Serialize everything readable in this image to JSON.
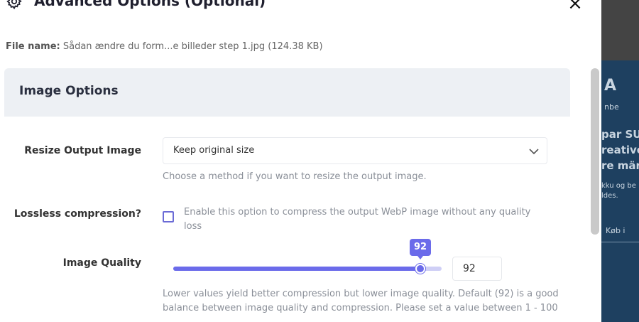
{
  "dialog": {
    "title": "Advanced Options (Optional)",
    "icon": "gear-icon",
    "close_icon": "close-icon",
    "file_label": "File name:",
    "file_value": "Sådan ændre du form...e billeder step 1.jpg (124.38 KB)"
  },
  "section": {
    "title": "Image Options"
  },
  "resize": {
    "label": "Resize Output Image",
    "selected": "Keep original size",
    "help": "Choose a method if you want to resize the output image."
  },
  "lossless": {
    "label": "Lossless compression?",
    "checked": false,
    "help": "Enable this option to compress the output WebP image without any quality loss"
  },
  "quality": {
    "label": "Image Quality",
    "value": "92",
    "fraction": 0.92,
    "help": "Lower values yield better compression but lower image quality. Default (92) is a good balance between image quality and compression. Please set a value between 1 - 100"
  },
  "colors": {
    "accent": "#6b6bea",
    "section_bg": "#edf0f4"
  },
  "background_page": {
    "logo": "A",
    "logo_sub": "nbe",
    "line1": "par SUV",
    "line2": "reative",
    "line3": "re mär",
    "small1": "kku og be",
    "small2": "ldes.",
    "link": "Køb i"
  }
}
